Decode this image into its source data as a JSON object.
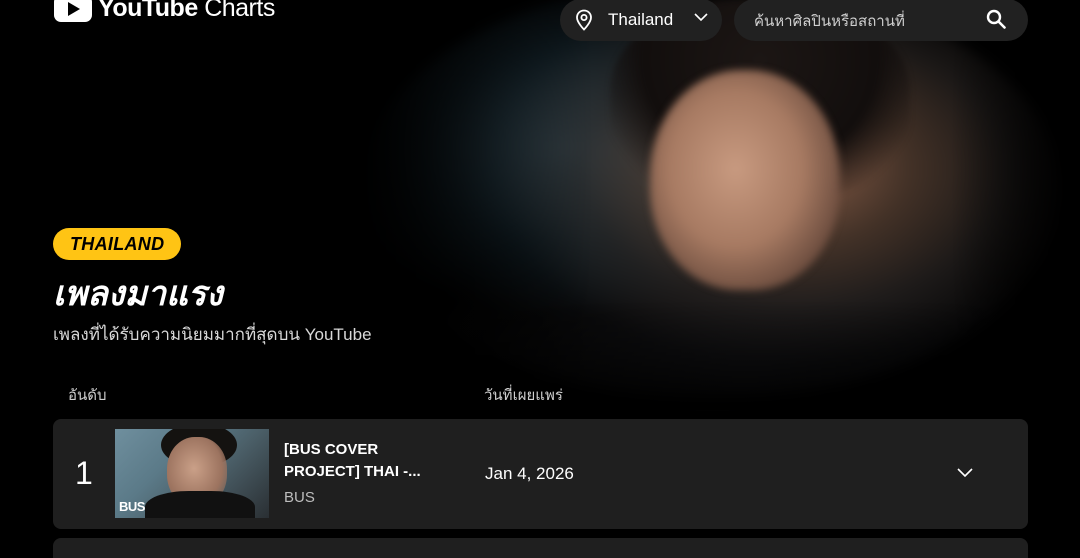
{
  "header": {
    "logo_brand": "YouTube",
    "logo_product": "Charts",
    "country": "Thailand",
    "search_placeholder": "ค้นหาศิลปินหรือสถานที่"
  },
  "hero": {
    "badge": "THAILAND",
    "title": "เพลงมาแรง",
    "subtitle": "เพลงที่ได้รับความนิยมมากที่สุดบน YouTube"
  },
  "table": {
    "columns": {
      "rank": "อันดับ",
      "release_date": "วันที่เผยแพร่"
    },
    "rows": [
      {
        "rank": "1",
        "title": "[BUS COVER PROJECT] THAI -...",
        "artist": "BUS",
        "release_date": "Jan 4, 2026",
        "thumb_logo": "BUS"
      }
    ]
  },
  "colors": {
    "badge_bg": "#ffc414",
    "surface": "#1f1f1f",
    "background": "#000000"
  },
  "icons": {
    "location": "location-pin-icon",
    "dropdown": "chevron-down-icon",
    "search": "search-icon",
    "expand": "chevron-down-icon"
  }
}
